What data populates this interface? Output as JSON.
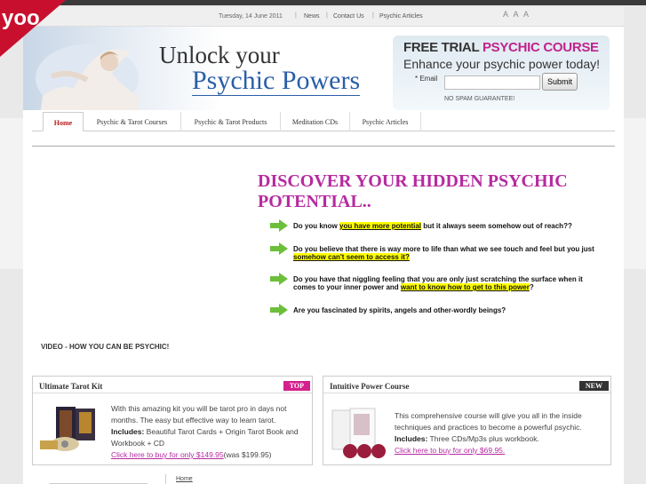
{
  "topbar": {
    "date": "Tuesday, 14 June 2011",
    "links": [
      "News",
      "Contact Us",
      "Psychic Articles"
    ],
    "resize_glyphs": "A A A"
  },
  "header": {
    "line1": "Unlock your",
    "line2": "Psychic Powers"
  },
  "trial": {
    "title_plain": "FREE TRIAL ",
    "title_highlight": "PSYCHIC COURSE",
    "subtitle": "Enhance your psychic power today!",
    "email_label": "* Email",
    "email_value": "",
    "submit_label": "Submit",
    "no_spam": "NO SPAM GUARANTEE!"
  },
  "logo": {
    "text": "yoo"
  },
  "nav": {
    "items": [
      "Home",
      "Psychic & Tarot Courses",
      "Psychic & Tarot Products",
      "Meditation CDs",
      "Psychic Articles"
    ]
  },
  "main": {
    "headline": "DISCOVER YOUR HIDDEN PSYCHIC POTENTIAL..",
    "bullets": [
      {
        "pre": "Do you know ",
        "hl": "you have more potential",
        "post": " but it always seem somehow out of reach??"
      },
      {
        "pre": "Do you believe that there is way more to life than what we see touch and feel but you just ",
        "hl": "somehow can't seem to access it?",
        "post": ""
      },
      {
        "pre": "Do you have that niggling feeling that you are only just scratching the surface when it comes to your inner power and ",
        "hl": "want to know how to get to this power",
        "post": "?"
      },
      {
        "pre": "Are you fascinated by spirits, angels and other-wordly beings?",
        "hl": "",
        "post": ""
      }
    ],
    "video_label": "VIDEO - HOW YOU CAN BE PSYCHIC!"
  },
  "products": [
    {
      "title": "Ultimate Tarot Kit",
      "badge": "TOP",
      "intro": "With this amazing kit you will be tarot pro in days not months. The easy but effective way to learn tarot.",
      "includes_label": "Includes:",
      "includes": " Beautiful Tarot Cards + Origin Tarot Book and Workbook + CD",
      "buy": "Click here to buy for only $149.95",
      "was": "(was $199.95)"
    },
    {
      "title": "Intuitive Power Course",
      "badge": "NEW",
      "intro": "This comprehensive course will give you all in the inside techniques and practices to become a powerful psychic.",
      "includes_label": "Includes:",
      "includes": " Three CDs/Mp3s plus workbook.",
      "buy": "Click here to buy for only $69.95.",
      "was": ""
    }
  ],
  "footer": {
    "home": "Home"
  },
  "colors": {
    "accent": "#b62aa0",
    "nav_active": "#b81c1c",
    "highlight": "#ffff00",
    "badge_top": "#d4208c",
    "badge_new": "#333333"
  }
}
